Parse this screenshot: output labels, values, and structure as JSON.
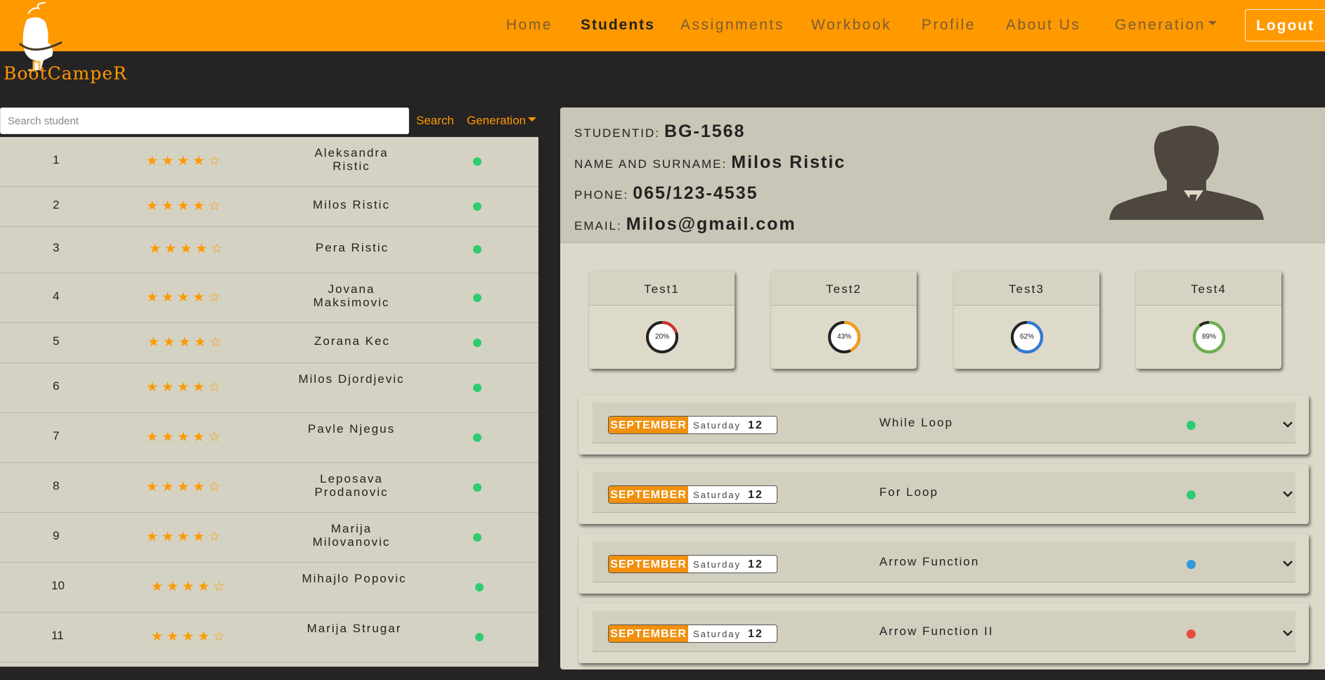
{
  "brand": {
    "logo_text": "BootCampeR"
  },
  "nav": {
    "items": [
      {
        "label": "Home",
        "active": false
      },
      {
        "label": "Students",
        "active": true
      },
      {
        "label": "Assignments",
        "active": false
      },
      {
        "label": "Workbook",
        "active": false
      },
      {
        "label": "Profile",
        "active": false
      },
      {
        "label": "About Us",
        "active": false
      },
      {
        "label": "Generation",
        "active": false
      }
    ],
    "logout": "Logout"
  },
  "search": {
    "placeholder": "Search student",
    "button": "Search",
    "generation": "Generation"
  },
  "students": [
    {
      "num": "1",
      "name": "Aleksandra Ristic",
      "stars": "★★★★☆",
      "status": "#2ecc71"
    },
    {
      "num": "2",
      "name": "Milos Ristic",
      "stars": "★★★★☆",
      "status": "#2ecc71"
    },
    {
      "num": "3",
      "name": "Pera Ristic",
      "stars": "★★★★☆",
      "status": "#2ecc71"
    },
    {
      "num": "4",
      "name": "Jovana Maksimovic",
      "stars": "★★★★☆",
      "status": "#2ecc71"
    },
    {
      "num": "5",
      "name": "Zorana Kec",
      "stars": "★★★★☆",
      "status": "#2ecc71"
    },
    {
      "num": "6",
      "name": "Milos Djordjevic",
      "stars": "★★★★☆",
      "status": "#2ecc71"
    },
    {
      "num": "7",
      "name": "Pavle Njegus",
      "stars": "★★★★☆",
      "status": "#2ecc71"
    },
    {
      "num": "8",
      "name": "Leposava Prodanovic",
      "stars": "★★★★☆",
      "status": "#2ecc71"
    },
    {
      "num": "9",
      "name": "Marija Milovanovic",
      "stars": "★★★★☆",
      "status": "#2ecc71"
    },
    {
      "num": "10",
      "name": "Mihajlo Popovic",
      "stars": "★★★★☆",
      "status": "#2ecc71"
    },
    {
      "num": "11",
      "name": "Marija Strugar",
      "stars": "★★★★☆",
      "status": "#2ecc71"
    }
  ],
  "profile": {
    "id_label": "STUDENTID:",
    "id": "BG-1568",
    "name_label": "NAME AND SURNAME:",
    "name": "Milos Ristic",
    "phone_label": "PHONE:",
    "phone": "065/123-4535",
    "email_label": "EMAIL:",
    "email": "Milos@gmail.com"
  },
  "tests": [
    {
      "label": "Test1",
      "pct": "20%",
      "value": 20,
      "color": "#d0342c"
    },
    {
      "label": "Test2",
      "pct": "43%",
      "value": 43,
      "color": "#f39c12"
    },
    {
      "label": "Test3",
      "pct": "62%",
      "value": 62,
      "color": "#2f7ad6"
    },
    {
      "label": "Test4",
      "pct": "89%",
      "value": 89,
      "color": "#6ab04c"
    }
  ],
  "assignments": [
    {
      "month": "SEPTEMBER",
      "day": "Saturday",
      "date": "12",
      "title": "While Loop",
      "status": "#2ecc71"
    },
    {
      "month": "SEPTEMBER",
      "day": "Saturday",
      "date": "12",
      "title": "For Loop",
      "status": "#2ecc71"
    },
    {
      "month": "SEPTEMBER",
      "day": "Saturday",
      "date": "12",
      "title": "Arrow Function",
      "status": "#3498db"
    },
    {
      "month": "SEPTEMBER",
      "day": "Saturday",
      "date": "12",
      "title": "Arrow Function II",
      "status": "#e74c3c"
    }
  ]
}
